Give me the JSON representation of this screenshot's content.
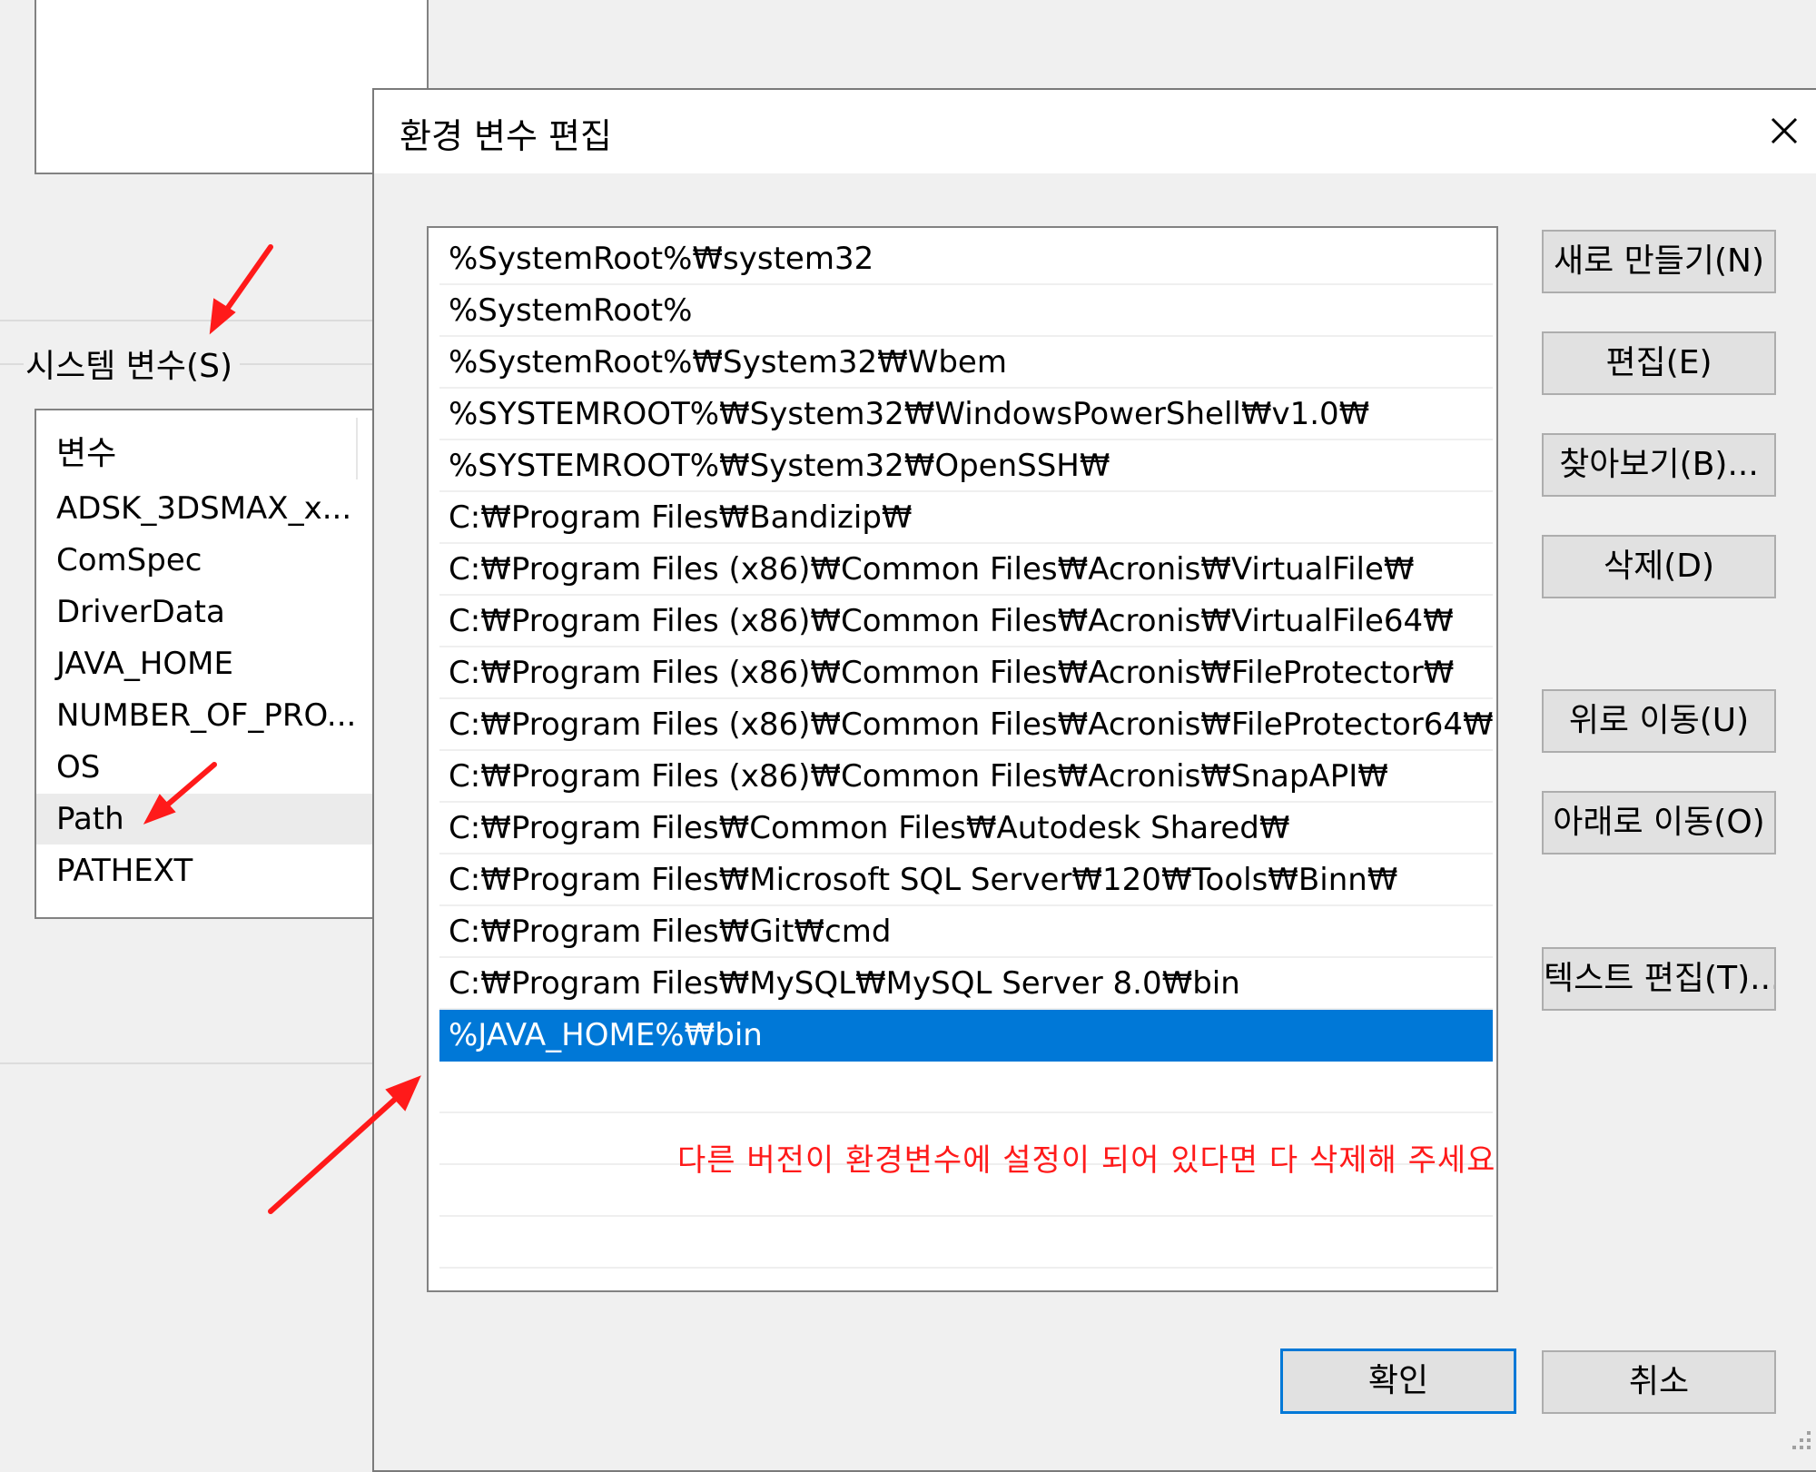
{
  "background_window": {
    "group_label": "시스템 변수(S)",
    "list_header": "변수",
    "variables": [
      {
        "name": "ADSK_3DSMAX_x...",
        "selected": false
      },
      {
        "name": "ComSpec",
        "selected": false
      },
      {
        "name": "DriverData",
        "selected": false
      },
      {
        "name": "JAVA_HOME",
        "selected": false
      },
      {
        "name": "NUMBER_OF_PRO...",
        "selected": false
      },
      {
        "name": "OS",
        "selected": false
      },
      {
        "name": "Path",
        "selected": true
      },
      {
        "name": "PATHEXT",
        "selected": false
      }
    ]
  },
  "dialog": {
    "title": "환경 변수 편집",
    "close_icon": "close-icon",
    "paths": [
      {
        "value": "%SystemRoot%₩system32",
        "selected": false
      },
      {
        "value": "%SystemRoot%",
        "selected": false
      },
      {
        "value": "%SystemRoot%₩System32₩Wbem",
        "selected": false
      },
      {
        "value": "%SYSTEMROOT%₩System32₩WindowsPowerShell₩v1.0₩",
        "selected": false
      },
      {
        "value": "%SYSTEMROOT%₩System32₩OpenSSH₩",
        "selected": false
      },
      {
        "value": "C:₩Program Files₩Bandizip₩",
        "selected": false
      },
      {
        "value": "C:₩Program Files (x86)₩Common Files₩Acronis₩VirtualFile₩",
        "selected": false
      },
      {
        "value": "C:₩Program Files (x86)₩Common Files₩Acronis₩VirtualFile64₩",
        "selected": false
      },
      {
        "value": "C:₩Program Files (x86)₩Common Files₩Acronis₩FileProtector₩",
        "selected": false
      },
      {
        "value": "C:₩Program Files (x86)₩Common Files₩Acronis₩FileProtector64₩",
        "selected": false
      },
      {
        "value": "C:₩Program Files (x86)₩Common Files₩Acronis₩SnapAPI₩",
        "selected": false
      },
      {
        "value": "C:₩Program Files₩Common Files₩Autodesk Shared₩",
        "selected": false
      },
      {
        "value": "C:₩Program Files₩Microsoft SQL Server₩120₩Tools₩Binn₩",
        "selected": false
      },
      {
        "value": "C:₩Program Files₩Git₩cmd",
        "selected": false
      },
      {
        "value": "C:₩Program Files₩MySQL₩MySQL Server 8.0₩bin",
        "selected": false
      },
      {
        "value": "%JAVA_HOME%₩bin",
        "selected": true
      }
    ],
    "annotation": "다른 버전이 환경변수에 설정이 되어 있다면 다 삭제해 주세요",
    "buttons": {
      "new": "새로 만들기(N)",
      "edit": "편집(E)",
      "browse": "찾아보기(B)...",
      "delete": "삭제(D)",
      "move_up": "위로 이동(U)",
      "move_down": "아래로 이동(O)",
      "edit_text": "텍스트 편집(T)...",
      "ok": "확인",
      "cancel": "취소"
    }
  },
  "colors": {
    "selection": "#0078d7",
    "annotation": "#ff1a1a",
    "arrow": "#ff1a1a"
  }
}
